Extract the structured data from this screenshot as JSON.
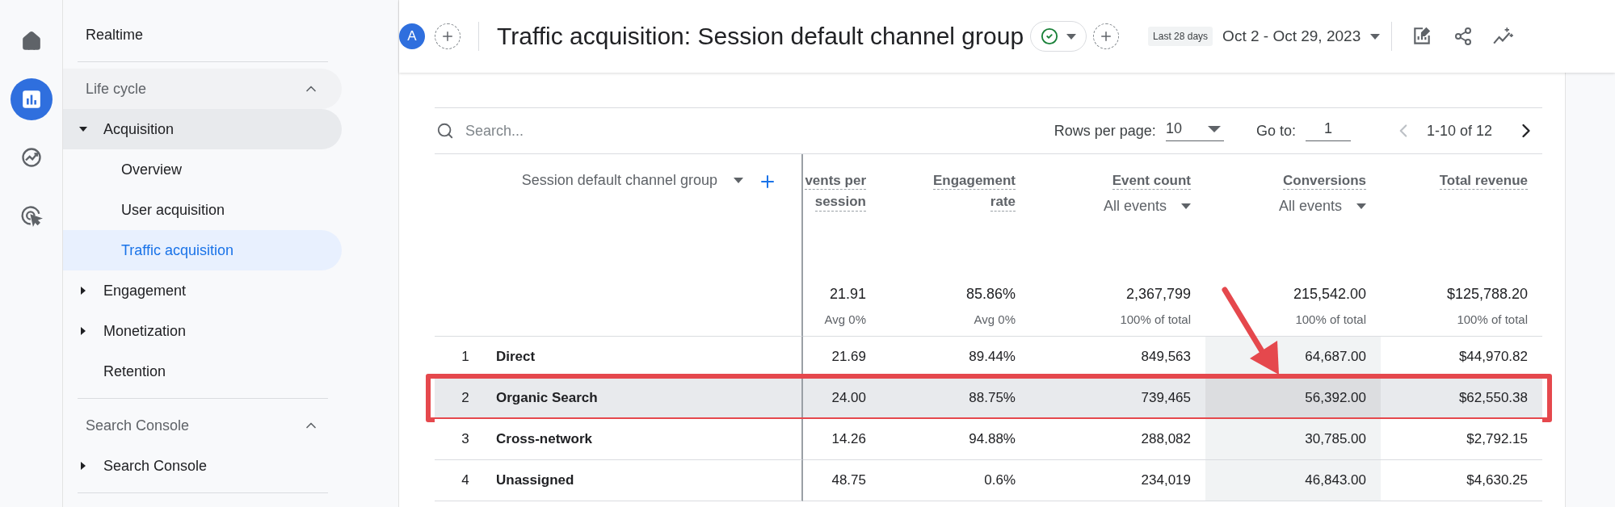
{
  "rail": [
    {
      "selected": false
    },
    {
      "selected": true
    },
    {
      "selected": false
    },
    {
      "selected": false
    }
  ],
  "sidebar": {
    "top_link": {
      "label": "Realtime"
    },
    "sections": [
      {
        "title": "Life cycle",
        "expanded": true,
        "items": [
          {
            "label": "Acquisition",
            "expandable": true,
            "expanded": true,
            "children": [
              {
                "label": "Overview",
                "selected": false
              },
              {
                "label": "User acquisition",
                "selected": false
              },
              {
                "label": "Traffic acquisition",
                "selected": true
              }
            ]
          },
          {
            "label": "Engagement",
            "expandable": true,
            "expanded": false
          },
          {
            "label": "Monetization",
            "expandable": true,
            "expanded": false
          },
          {
            "label": "Retention",
            "expandable": false,
            "expanded": false
          }
        ]
      },
      {
        "title": "Search Console",
        "expanded": true,
        "items": [
          {
            "label": "Search Console",
            "expandable": true,
            "expanded": false
          }
        ]
      }
    ]
  },
  "top_bar": {
    "avatar": "A",
    "title": "Traffic acquisition: Session default channel group",
    "date_chip": "Last 28 days",
    "date_range": "Oct 2 - Oct 29, 2023"
  },
  "table": {
    "search_placeholder": "Search...",
    "rows_per_page_label": "Rows per page:",
    "rows_per_page": "10",
    "goto_label": "Go to:",
    "goto_value": "1",
    "page_range": "1-10 of 12",
    "dimension_header": "Session default channel group",
    "columns": [
      {
        "lines": [
          "vents per",
          "session"
        ],
        "highlighted": false
      },
      {
        "lines": [
          "Engagement",
          "rate"
        ],
        "highlighted": false
      },
      {
        "lines": [
          "Event count"
        ],
        "selector": "All events",
        "highlighted": false
      },
      {
        "lines": [
          "Conversions"
        ],
        "selector": "All events",
        "highlighted": true
      },
      {
        "lines": [
          "Total revenue"
        ],
        "highlighted": false
      }
    ],
    "totals": [
      {
        "value": "21.91",
        "note": "Avg 0%"
      },
      {
        "value": "85.86%",
        "note": "Avg 0%"
      },
      {
        "value": "2,367,799",
        "note": "100% of total"
      },
      {
        "value": "215,542.00",
        "note": "100% of total"
      },
      {
        "value": "$125,788.20",
        "note": "100% of total"
      }
    ],
    "rows": [
      {
        "rank": "1",
        "name": "Direct",
        "selected": false,
        "annotated": false,
        "values": [
          "21.69",
          "89.44%",
          "849,563",
          "64,687.00",
          "$44,970.82"
        ]
      },
      {
        "rank": "2",
        "name": "Organic Search",
        "selected": true,
        "annotated": true,
        "values": [
          "24.00",
          "88.75%",
          "739,465",
          "56,392.00",
          "$62,550.38"
        ]
      },
      {
        "rank": "3",
        "name": "Cross-network",
        "selected": false,
        "annotated": false,
        "values": [
          "14.26",
          "94.88%",
          "288,082",
          "30,785.00",
          "$2,792.15"
        ]
      },
      {
        "rank": "4",
        "name": "Unassigned",
        "selected": false,
        "annotated": false,
        "values": [
          "48.75",
          "0.6%",
          "234,019",
          "46,843.00",
          "$4,630.25"
        ]
      }
    ]
  }
}
